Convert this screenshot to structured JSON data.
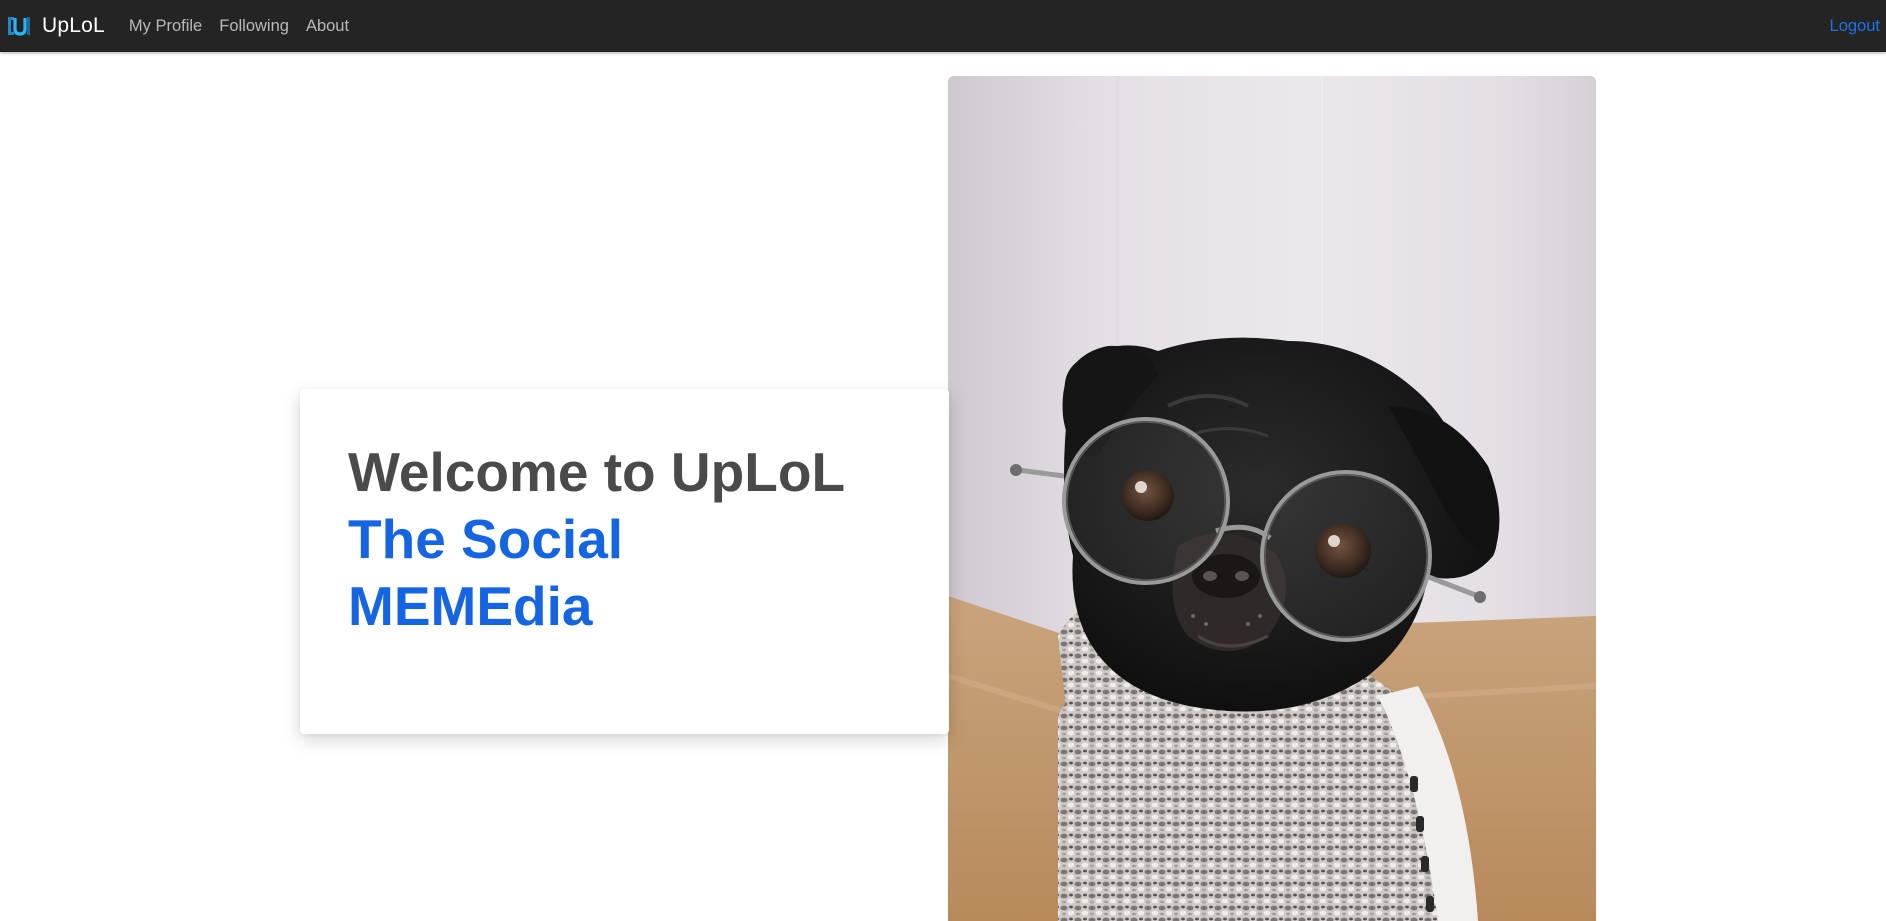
{
  "navbar": {
    "brand_name": "UpLoL",
    "links": [
      "My Profile",
      "Following",
      "About"
    ],
    "logout_label": "Logout"
  },
  "hero": {
    "title": "Welcome to UpLoL",
    "subtitle": "The Social MEMEdia"
  },
  "photo": {
    "description_icon": "pug-with-glasses-photo"
  },
  "colors": {
    "navbar_bg": "#242424",
    "brand_text": "#ffffff",
    "nav_link": "#b9b9b9",
    "logout_link": "#1a73e8",
    "title_text": "#4a4a4a",
    "subtitle_text": "#1565e3"
  }
}
